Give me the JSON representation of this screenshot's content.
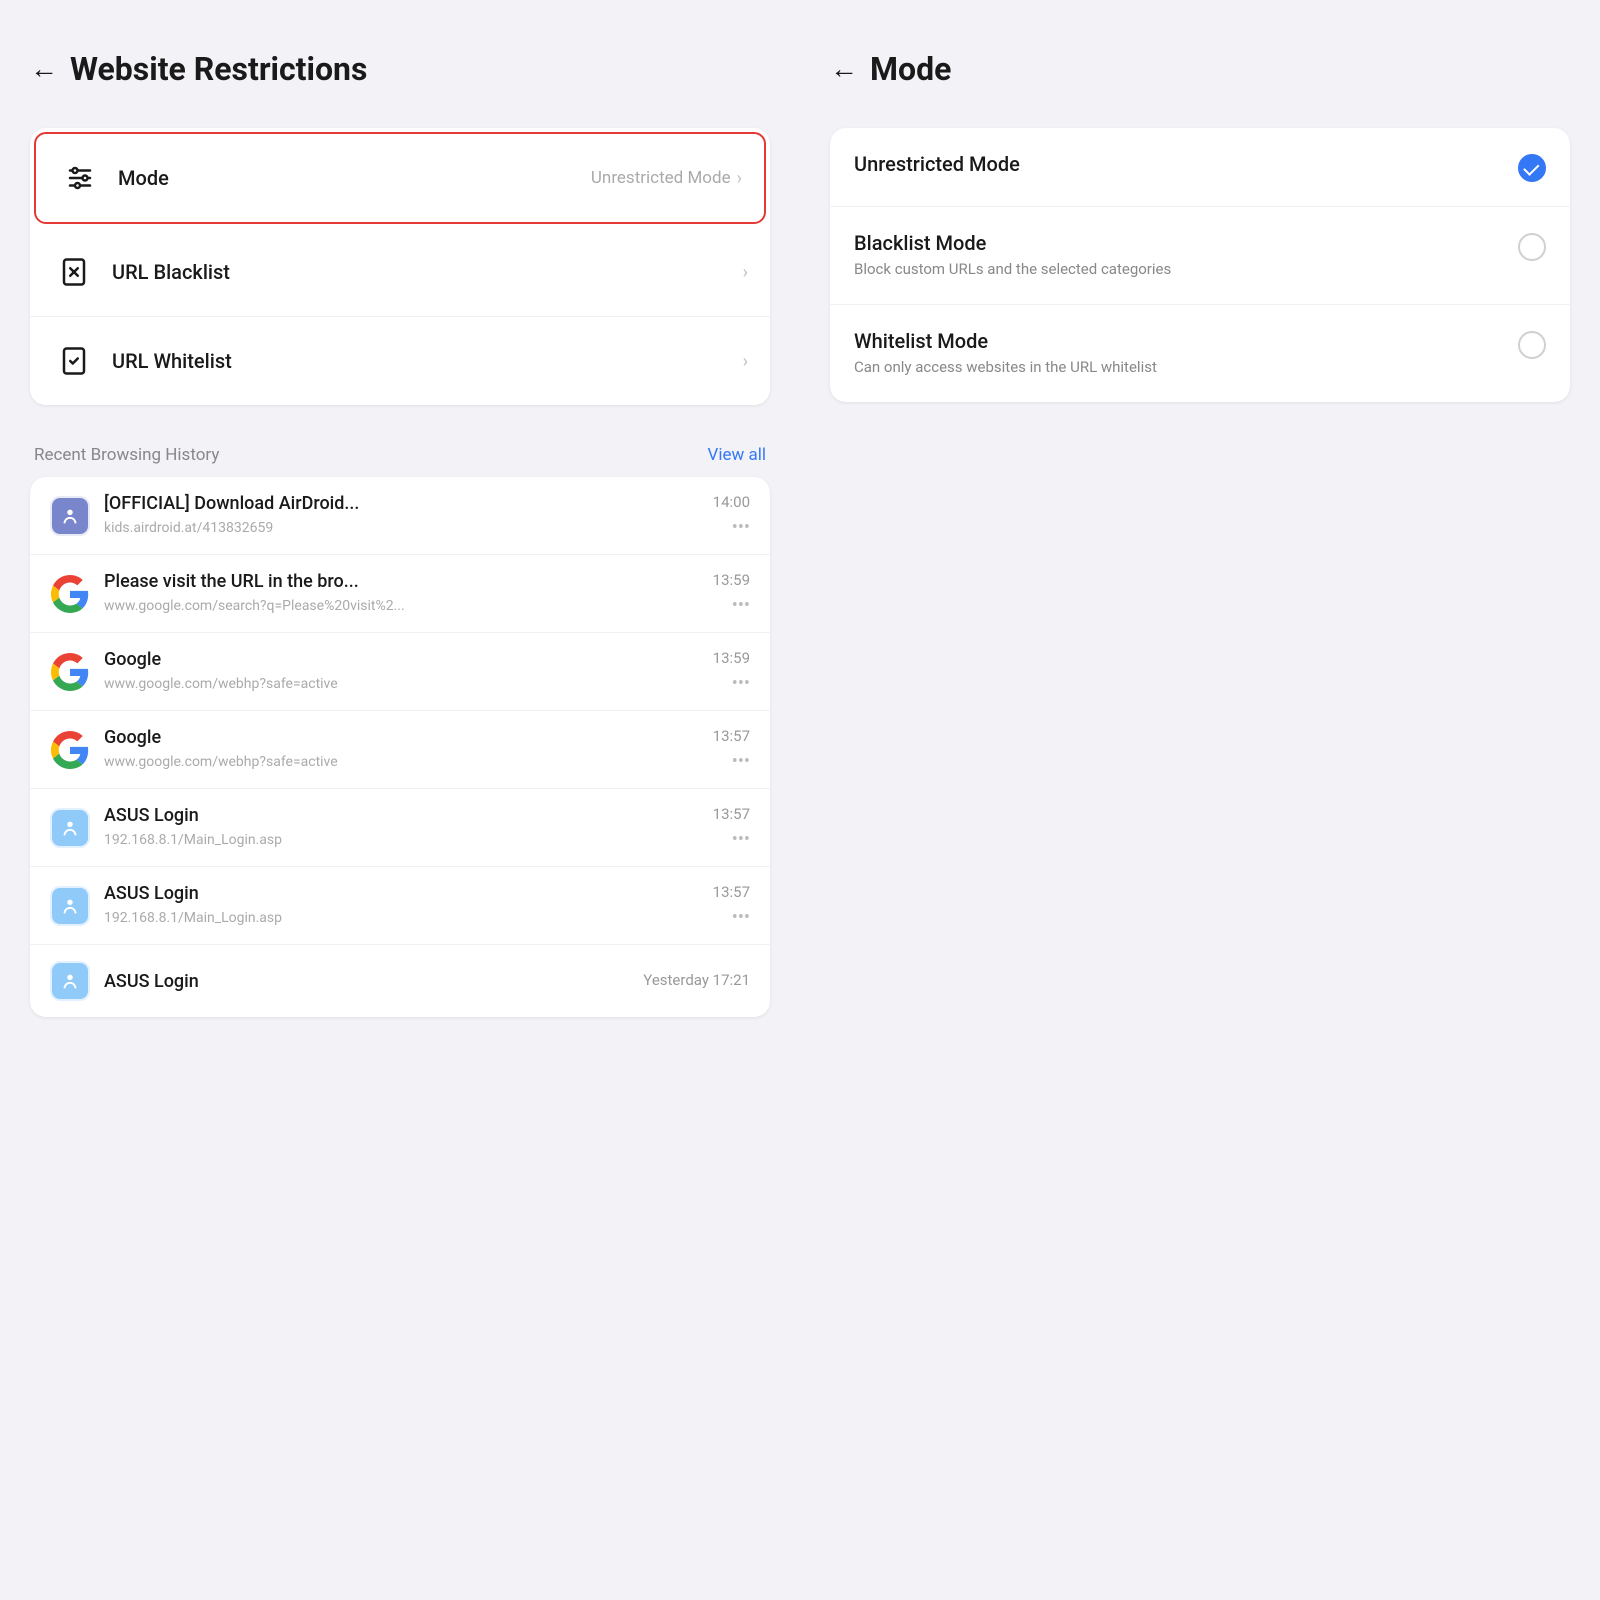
{
  "leftPanel": {
    "header": {
      "back_label": "←",
      "title": "Website Restrictions"
    },
    "settingsItems": [
      {
        "id": "mode",
        "icon": "sliders-icon",
        "label": "Mode",
        "value": "Unrestricted Mode",
        "highlighted": true
      },
      {
        "id": "url-blacklist",
        "icon": "url-blacklist-icon",
        "label": "URL Blacklist",
        "value": "",
        "highlighted": false
      },
      {
        "id": "url-whitelist",
        "icon": "url-whitelist-icon",
        "label": "URL Whitelist",
        "value": "",
        "highlighted": false
      }
    ],
    "recentHistory": {
      "sectionLabel": "Recent Browsing History",
      "viewAllLabel": "View all",
      "items": [
        {
          "id": "history-1",
          "favicon": "airdroid",
          "title": "[OFFICIAL] Download AirDroid...",
          "time": "14:00",
          "url": "kids.airdroid.at/413832659"
        },
        {
          "id": "history-2",
          "favicon": "google",
          "title": "Please visit the URL in the bro...",
          "time": "13:59",
          "url": "www.google.com/search?q=Please%20visit%2..."
        },
        {
          "id": "history-3",
          "favicon": "google",
          "title": "Google",
          "time": "13:59",
          "url": "www.google.com/webhp?safe=active"
        },
        {
          "id": "history-4",
          "favicon": "google",
          "title": "Google",
          "time": "13:57",
          "url": "www.google.com/webhp?safe=active"
        },
        {
          "id": "history-5",
          "favicon": "asus",
          "title": "ASUS Login",
          "time": "13:57",
          "url": "192.168.8.1/Main_Login.asp"
        },
        {
          "id": "history-6",
          "favicon": "asus",
          "title": "ASUS Login",
          "time": "13:57",
          "url": "192.168.8.1/Main_Login.asp"
        },
        {
          "id": "history-7",
          "favicon": "asus",
          "title": "ASUS Login",
          "time": "Yesterday 17:21",
          "url": ""
        }
      ]
    }
  },
  "rightPanel": {
    "header": {
      "back_label": "←",
      "title": "Mode"
    },
    "modeItems": [
      {
        "id": "unrestricted",
        "title": "Unrestricted Mode",
        "description": "",
        "selected": true
      },
      {
        "id": "blacklist",
        "title": "Blacklist Mode",
        "description": "Block custom URLs and the selected categories",
        "selected": false
      },
      {
        "id": "whitelist",
        "title": "Whitelist Mode",
        "description": "Can only access websites in the URL whitelist",
        "selected": false
      }
    ]
  },
  "colors": {
    "accent": "#3478f6",
    "highlight_border": "#e53935",
    "text_primary": "#1a1a1a",
    "text_secondary": "#888",
    "text_muted": "#aaa",
    "background": "#f2f2f7",
    "card_bg": "#ffffff"
  }
}
